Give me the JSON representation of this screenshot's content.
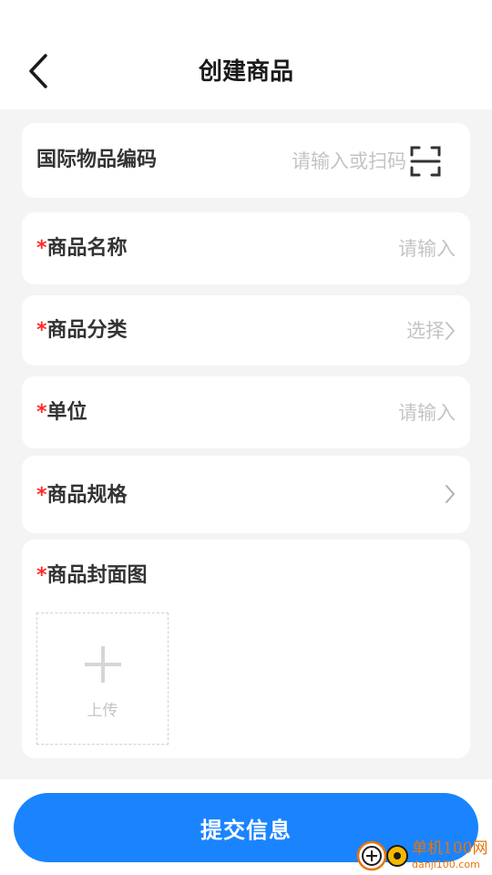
{
  "header": {
    "title": "创建商品",
    "back_icon": "chevron-left-icon"
  },
  "form": {
    "barcode": {
      "label": "国际物品编码",
      "placeholder": "请输入或扫码",
      "icon": "scan-icon"
    },
    "name": {
      "required_mark": "*",
      "label": "商品名称",
      "placeholder": "请输入"
    },
    "category": {
      "required_mark": "*",
      "label": "商品分类",
      "value": "选择"
    },
    "unit": {
      "required_mark": "*",
      "label": "单位",
      "placeholder": "请输入"
    },
    "spec": {
      "required_mark": "*",
      "label": "商品规格"
    },
    "cover": {
      "required_mark": "*",
      "label": "商品封面图",
      "upload_label": "上传"
    }
  },
  "footer": {
    "submit_label": "提交信息"
  },
  "watermark": {
    "text": "单机100网",
    "sub": "danji100.com"
  },
  "colors": {
    "accent": "#1a84ff",
    "required": "#ff2a2a",
    "placeholder": "#c4c4c4",
    "background": "#f4f4f4"
  }
}
